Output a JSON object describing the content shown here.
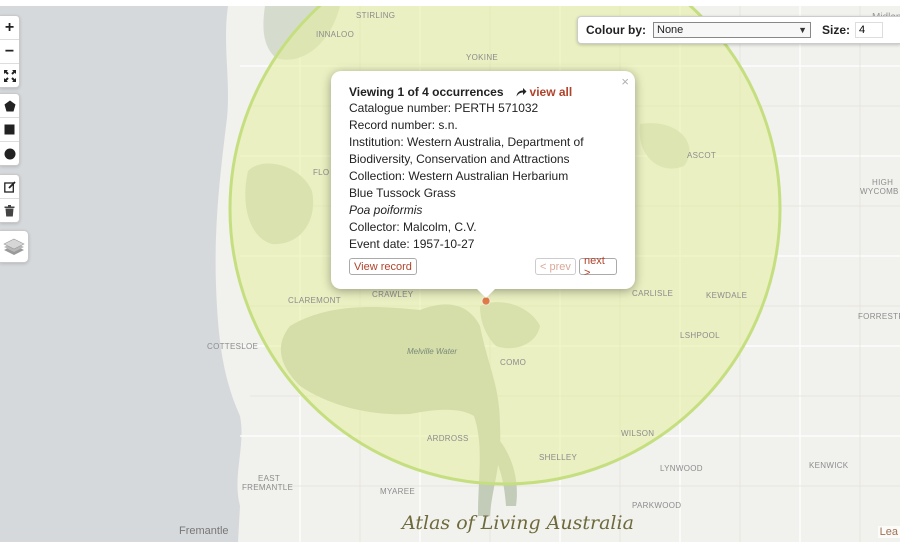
{
  "map": {
    "places": [
      {
        "id": "stirling",
        "text": "STIRLING"
      },
      {
        "id": "innaloo",
        "text": "INNALOO"
      },
      {
        "id": "yokine",
        "text": "YOKINE"
      },
      {
        "id": "ascot",
        "text": "ASCOT"
      },
      {
        "id": "high-wycombe-1",
        "text": "HIGH"
      },
      {
        "id": "high-wycombe-2",
        "text": "WYCOMB"
      },
      {
        "id": "floreat",
        "text": "FLO"
      },
      {
        "id": "claremont",
        "text": "CLAREMONT"
      },
      {
        "id": "crawley",
        "text": "CRAWLEY"
      },
      {
        "id": "carlisle",
        "text": "CARLISLE"
      },
      {
        "id": "kewdale",
        "text": "KEWDALE"
      },
      {
        "id": "forrestfield",
        "text": "FORRESTF"
      },
      {
        "id": "cottesloe",
        "text": "COTTESLOE"
      },
      {
        "id": "welshpool",
        "text": "LSHPOOL"
      },
      {
        "id": "melville-water",
        "text": "Melville Water"
      },
      {
        "id": "como",
        "text": "COMO"
      },
      {
        "id": "ardross",
        "text": "ARDROSS"
      },
      {
        "id": "wilson",
        "text": "WILSON"
      },
      {
        "id": "shelley",
        "text": "SHELLEY"
      },
      {
        "id": "lynwood",
        "text": "LYNWOOD"
      },
      {
        "id": "kenwick",
        "text": "KENWICK"
      },
      {
        "id": "east-fremantle-1",
        "text": "EAST"
      },
      {
        "id": "east-fremantle-2",
        "text": "FREMANTLE"
      },
      {
        "id": "myaree",
        "text": "MYAREE"
      },
      {
        "id": "parkwood",
        "text": "PARKWOOD"
      },
      {
        "id": "fremantle",
        "text": "Fremantle"
      },
      {
        "id": "midland",
        "text": "Midland"
      }
    ],
    "watermark": "Atlas of Living Australia",
    "attribution": "Lea"
  },
  "controls": {
    "zoom_in": "+",
    "zoom_out": "−",
    "icons": [
      "zoom-in-icon",
      "zoom-out-icon",
      "fullscreen-icon",
      "draw-polygon-icon",
      "draw-rectangle-icon",
      "draw-circle-icon",
      "edit-icon",
      "trash-icon",
      "layers-icon"
    ]
  },
  "toolbar": {
    "colour_label": "Colour by:",
    "colour_value": "None",
    "size_label": "Size:",
    "size_value": "4"
  },
  "popup": {
    "title": "Viewing 1 of 4 occurrences",
    "view_all": "view all",
    "close": "×",
    "catalogue": "Catalogue number: PERTH 571032",
    "record_number": "Record number: s.n.",
    "institution_1": "Institution: Western Australia, Department of",
    "institution_2": "Biodiversity, Conservation and Attractions",
    "collection": "Collection: Western Australian Herbarium",
    "common_name": "Blue Tussock Grass",
    "scientific_name": "Poa poiformis",
    "collector": "Collector: Malcolm, C.V.",
    "event_date": "Event date: 1957-10-27",
    "view_record": "View record",
    "prev": "< prev",
    "next": "next >"
  },
  "colors": {
    "accent": "#b1432b",
    "circle_fill": "#e4ee9c",
    "circle_stroke": "#c5df80",
    "ocean": "#d6d9dc",
    "park": "#c3cbb9",
    "marker": "#e07b4a"
  }
}
